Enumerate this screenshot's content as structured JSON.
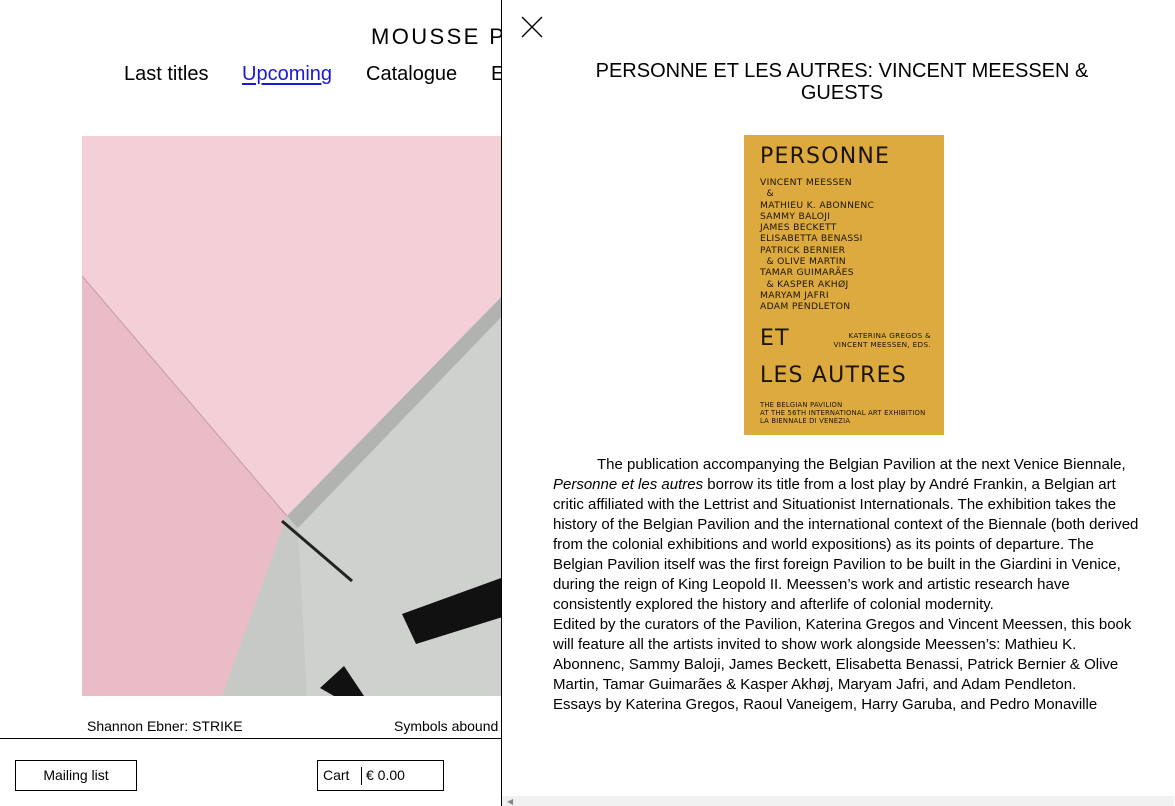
{
  "site": {
    "title": "MOUSSE P"
  },
  "nav": {
    "items": [
      {
        "label": "Last titles"
      },
      {
        "label": "Upcoming"
      },
      {
        "label": "Catalogue"
      },
      {
        "label": "E"
      }
    ]
  },
  "captions": {
    "left": "Shannon Ebner: STRIKE",
    "right": "Symbols abound"
  },
  "footer": {
    "mailing_label": "Mailing list",
    "cart_label": "Cart",
    "cart_total": "€ 0.00"
  },
  "panel": {
    "close_icon": "close-icon",
    "title": "PERSONNE ET LES AUTRES: VINCENT MEESSEN & GUESTS",
    "cover": {
      "background": "#dcaa3e",
      "top": "PERSONNE",
      "names": "VINCENT MEESSEN\n  &\nMATHIEU K. ABONNENC\nSAMMY BALOJI\nJAMES BECKETT\nELISABETTA BENASSI\nPATRICK BERNIER\n  & OLIVE MARTIN\nTAMAR GUIMARÃES\n  & KASPER AKHØJ\nMARYAM JAFRI\nADAM PENDLETON",
      "editors": "KATERINA GREGOS &\nVINCENT MEESSEN, EDS.",
      "middle": "ET",
      "bottom": "LES AUTRES",
      "subtitle": "THE BELGIAN PAVILION\nAT THE 56TH INTERNATIONAL ART EXHIBITION\nLA BIENNALE DI VENEZIA"
    },
    "p1_a": "The publication accompanying the Belgian Pavilion at the next Venice Biennale, ",
    "p1_italic": "Personne et les autres",
    "p1_b": " borrow its title from a lost play by André Frankin, a Belgian art critic affiliated with the Lettrist and Situationist Internationals. The exhibition takes the history of the Belgian Pavilion and the international context of the Biennale (both derived from the colonial exhibitions and world expositions) as its points of departure. The Belgian Pavilion itself was the first foreign Pavilion to be built in the Giardini in Venice, during the reign of King Leopold II. Meessen’s work and artistic research have consistently explored the history and afterlife of colonial modernity.",
    "p2": "Edited by the curators of the Pavilion, Katerina Gregos and Vincent Meessen, this book will feature all the artists invited to show work alongside Meessen’s: Mathieu K. Abonnenc, Sammy Baloji, James Beckett, Elisabetta Benassi, Patrick Bernier & Olive Martin, Tamar Guimarães & Kasper Akhøj, Maryam Jafri, and Adam Pendleton.",
    "p3": "Essays by Katerina Gregos, Raoul Vaneigem, Harry Garuba, and Pedro Monaville"
  }
}
